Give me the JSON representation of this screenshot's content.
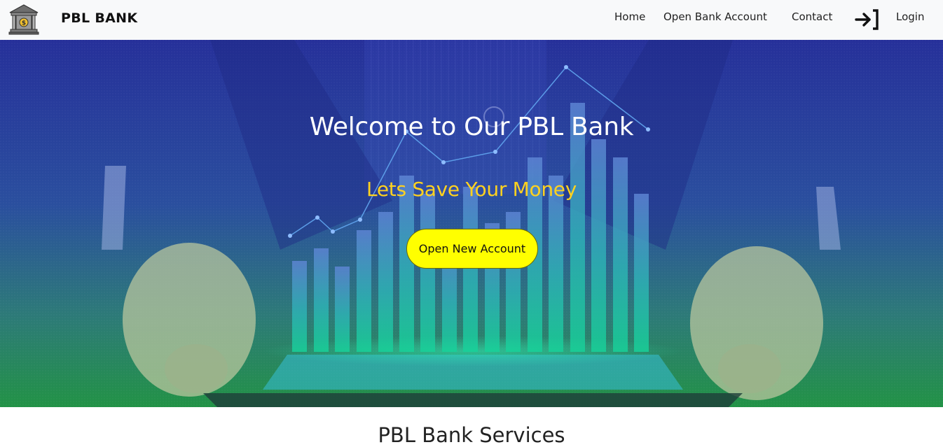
{
  "navbar": {
    "brand": "PBL BANK",
    "logo_icon": "bank-building-icon",
    "links": [
      "Home",
      "Open Bank Account",
      "Contact"
    ],
    "login_icon": "login-arrow-icon",
    "login_label": "Login"
  },
  "hero": {
    "title": "Welcome to Our PBL Bank",
    "subtitle": "Lets Save Your Money",
    "button_label": "Open New Account"
  },
  "services": {
    "heading": "PBL Bank Services"
  },
  "colors": {
    "navbar_bg": "#f8f9fa",
    "hero_blue": "#27349a",
    "hero_green": "#1f8a4a",
    "subtitle": "#ffd21f",
    "button_bg": "#ffff00"
  }
}
